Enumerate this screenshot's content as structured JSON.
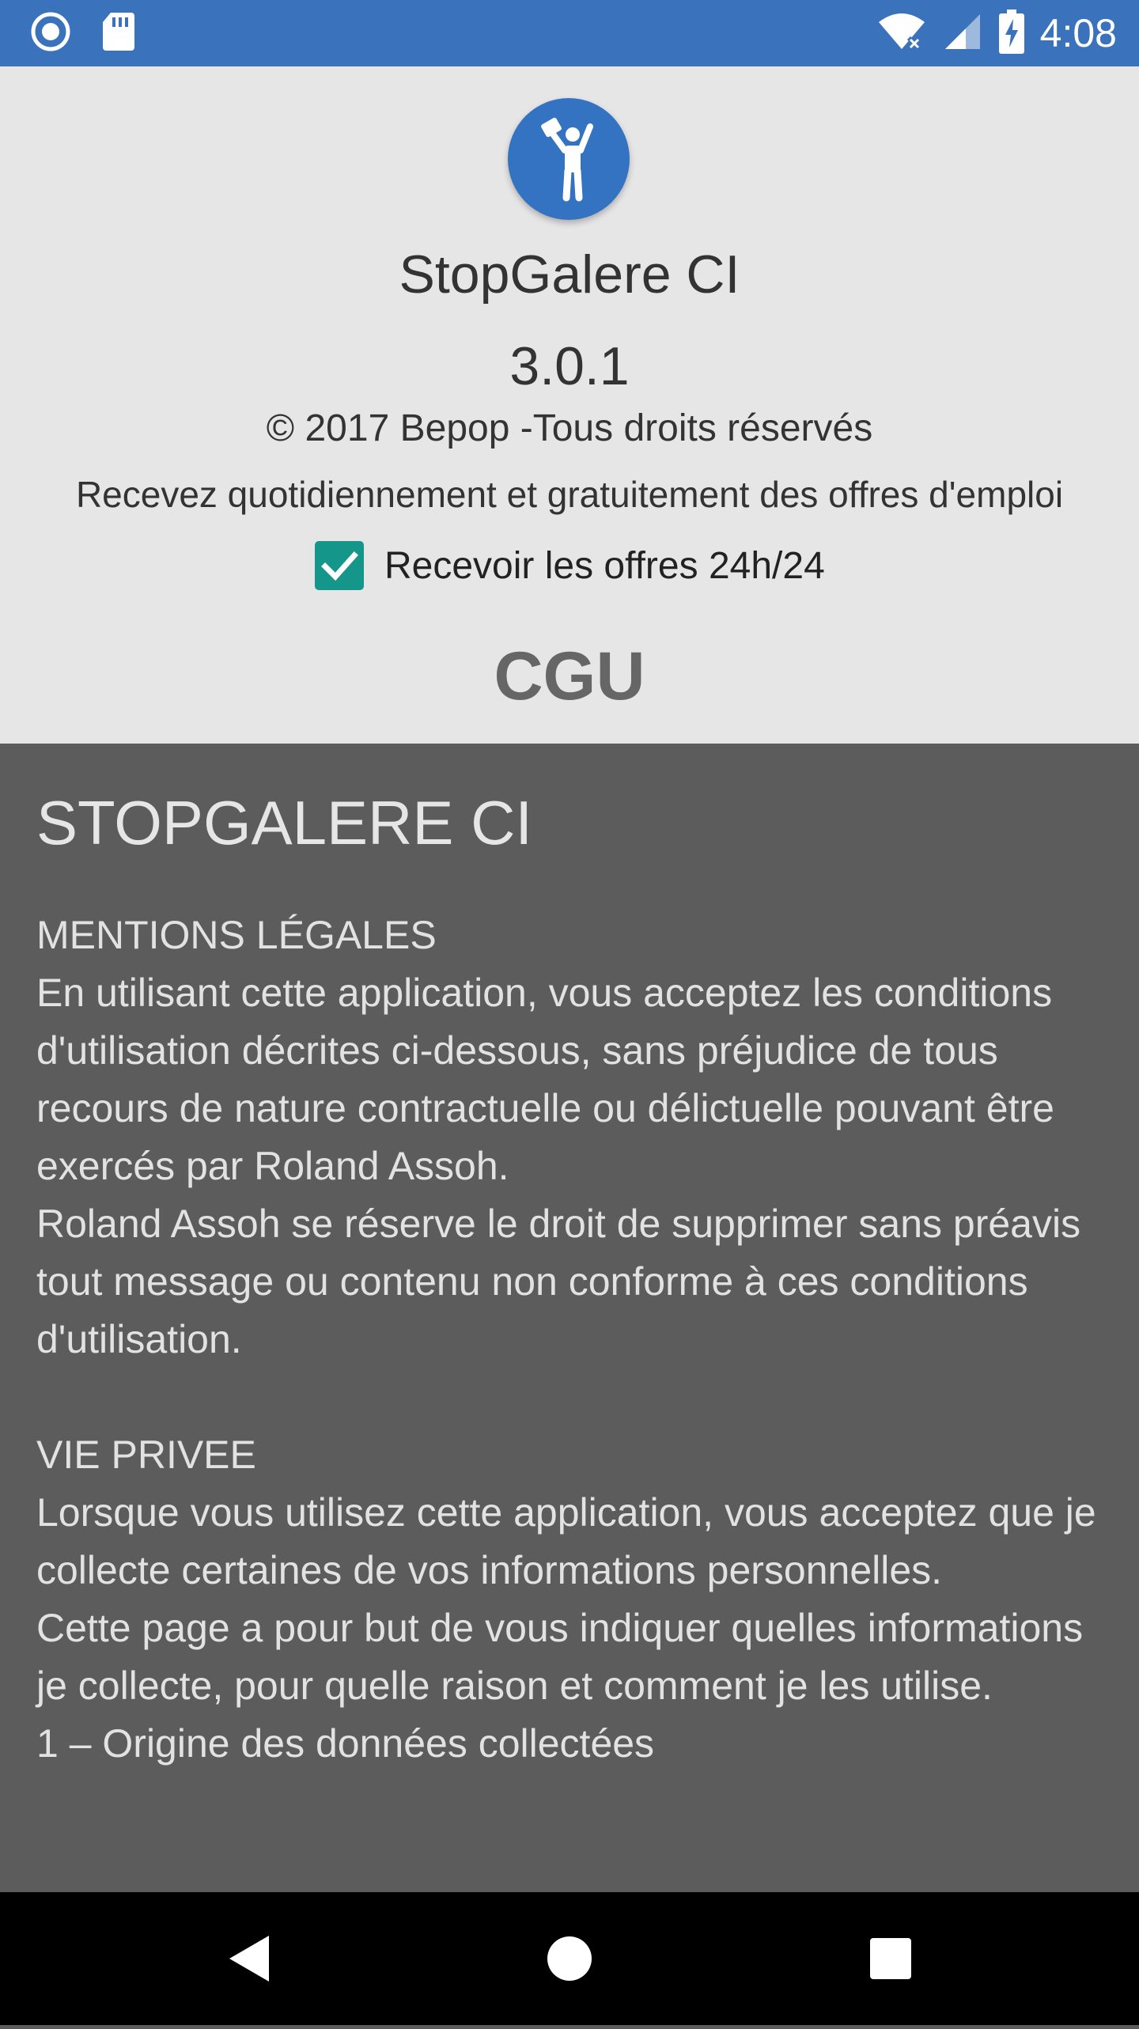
{
  "status_bar": {
    "time": "4:08",
    "icons": [
      "notification-icon",
      "sd-card-icon",
      "wifi-icon",
      "signal-icon",
      "battery-charging-icon"
    ]
  },
  "app": {
    "name": "StopGalere CI",
    "version": "3.0.1",
    "copyright": "© 2017 Bepop -Tous droits réservés",
    "subtitle": "Recevez quotidiennement et gratuitement des offres d'emploi",
    "logo_icon": "person-with-bag-icon"
  },
  "checkbox": {
    "label": "Recevoir les offres 24h/24",
    "checked": true,
    "color": "#15968a"
  },
  "cgu_heading": "CGU",
  "document": {
    "title": "STOPGALERE CI",
    "sections": [
      {
        "heading": "MENTIONS LÉGALES",
        "body": "En utilisant cette application, vous acceptez les conditions d'utilisation décrites ci-dessous, sans préjudice de tous recours de nature contractuelle ou délictuelle pouvant être exercés par Roland Assoh.\nRoland Assoh se réserve le droit de supprimer sans préavis tout message ou contenu non conforme à ces conditions d'utilisation."
      },
      {
        "heading": "VIE PRIVEE",
        "body": "Lorsque vous utilisez cette application, vous acceptez que je collecte certaines de vos informations personnelles.\nCette page a pour but de vous indiquer quelles informations je collecte, pour quelle raison et comment je les utilise.\n1 – Origine des données collectées"
      }
    ]
  },
  "colors": {
    "status_bar": "#3a72bb",
    "header_bg": "#e6e6e6",
    "content_bg": "#5c5c5c",
    "logo_bg": "#3473c1"
  },
  "nav_bar": {
    "buttons": [
      "back-icon",
      "home-icon",
      "recents-icon"
    ]
  }
}
